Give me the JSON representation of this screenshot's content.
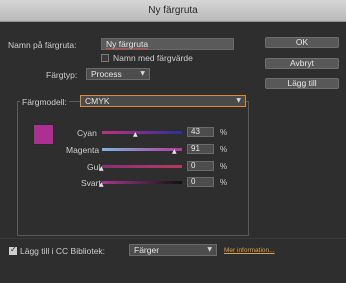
{
  "window": {
    "title": "Ny färgruta"
  },
  "form": {
    "name_label": "Namn på färgruta:",
    "name_value": "Ny färgruta",
    "name_with_value_label": "Namn med färgvärde",
    "color_type_label": "Färgtyp:",
    "color_type_value": "Process",
    "color_model_label": "Färgmodell:",
    "color_model_value": "CMYK"
  },
  "buttons": {
    "ok": "OK",
    "cancel": "Avbryt",
    "add": "Lägg till"
  },
  "channels": [
    {
      "label": "Cyan",
      "value": "43",
      "unit": "%",
      "level": 0.43
    },
    {
      "label": "Magenta",
      "value": "91",
      "unit": "%",
      "level": 0.91
    },
    {
      "label": "Gul",
      "value": "0",
      "unit": "%",
      "level": 0.0
    },
    {
      "label": "Svart",
      "value": "0",
      "unit": "%",
      "level": 0.0
    }
  ],
  "swatch_color": "#ad2f91",
  "footer": {
    "add_to_cc_label": "Lägg till i CC Bibliotek:",
    "library_value": "Färger",
    "more_info_link": "Mer information..."
  }
}
